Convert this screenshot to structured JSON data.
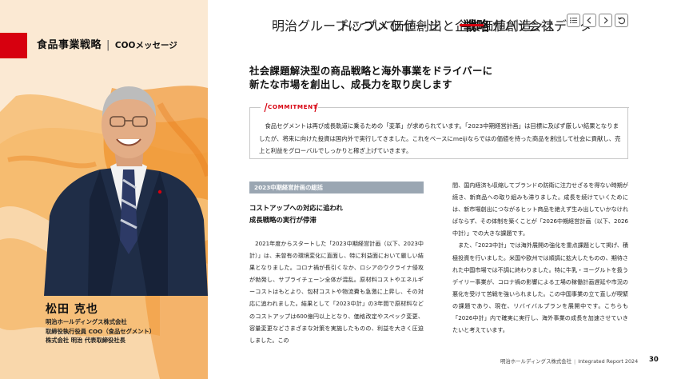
{
  "nav": {
    "items": [
      "明治グループについて",
      "トップメッセージ",
      "価値創出と企業価値創造",
      "戦略",
      "ガバナンス",
      "会社データ"
    ],
    "active_index": 3,
    "accent": "#d7000f"
  },
  "nav_buttons": [
    "menu-icon",
    "chevron-left-icon",
    "chevron-right-icon",
    "undo-icon"
  ],
  "section": {
    "title": "食品事業戦略",
    "subtitle": "COOメッセージ"
  },
  "executive": {
    "name": "松田 克也",
    "titles": [
      "明治ホールディングス株式会社",
      "取締役執行役員 COO（食品セグメント）",
      "株式会社 明治 代表取締役社長"
    ]
  },
  "headline": {
    "line1": "社会課題解決型の商品戦略と海外事業をドライバーに",
    "line2": "新たな市場を創出し、成長力を取り戻します"
  },
  "commitment": {
    "label": "COMMITMENT",
    "text": "食品セグメントは再び成長軌道に乗るための「変革」が求められています。「2023中期経営計画」は目標に及ばず厳しい結果となりましたが、将来に向けた投資は国内外で実行してきました。これをベースにmeijiならではの価値を持った商品を創出して社会に貢献し、売上と利益をグローバルでしっかりと稼ぎ上げていきます。"
  },
  "column_left": {
    "header": "2023中期経営計画の総括",
    "subhead_line1": "コストアップへの対応に追われ",
    "subhead_line2": "成長戦略の実行が停滞",
    "body": "2021年度からスタートした「2023中期経営計画（以下、2023中計）」は、未曾有の環境変化に直面し、特に利益面において厳しい結果となりました。コロナ禍が長引くなか、ロシアのウクライナ侵攻が勃発し、サプライチェーン全体が混乱。原材料コストやエネルギーコストはもとより、包材コストや物流費も急激に上昇し、その対応に追われました。結果として「2023中計」の3年間で原材料などのコストアップは600億円以上となり、価格改定やスペック変更、容量変更などさまざまな対策を実施したものの、利益を大きく圧迫しました。この"
  },
  "column_right": {
    "para1": "間、国内経済も収縮してブランドの防衛に注力せざるを得ない時期が続き、新商品への取り組みも滞りました。成長を続けていくためには、新市場創出につながるヒット商品を絶えず生み出していかなければならず、その体制を築くことが「2026中期経営計画（以下、2026中計）」での大きな課題です。",
    "para2": "また、「2023中計」では海外展開の強化を重点課題として掲げ、積極投資を行いました。米国や欧州では順調に拡大したものの、期待された中国市場では不調に終わりました。特に牛乳・ヨーグルトを扱うデイリー事業が、コロナ禍の影響による工場の稼働計画遅延や市況の悪化を受けて苦戦を強いられました。この中国事業の立て直しが喫緊の課題であり、現在、リバイバルプランを展開中です。こちらも「2026中計」内で確実に実行し、海外事業の成長を加速させていきたいと考えています。"
  },
  "footer": {
    "company": "明治ホールディングス株式会社",
    "report": "Integrated Report 2024",
    "page": "30"
  }
}
